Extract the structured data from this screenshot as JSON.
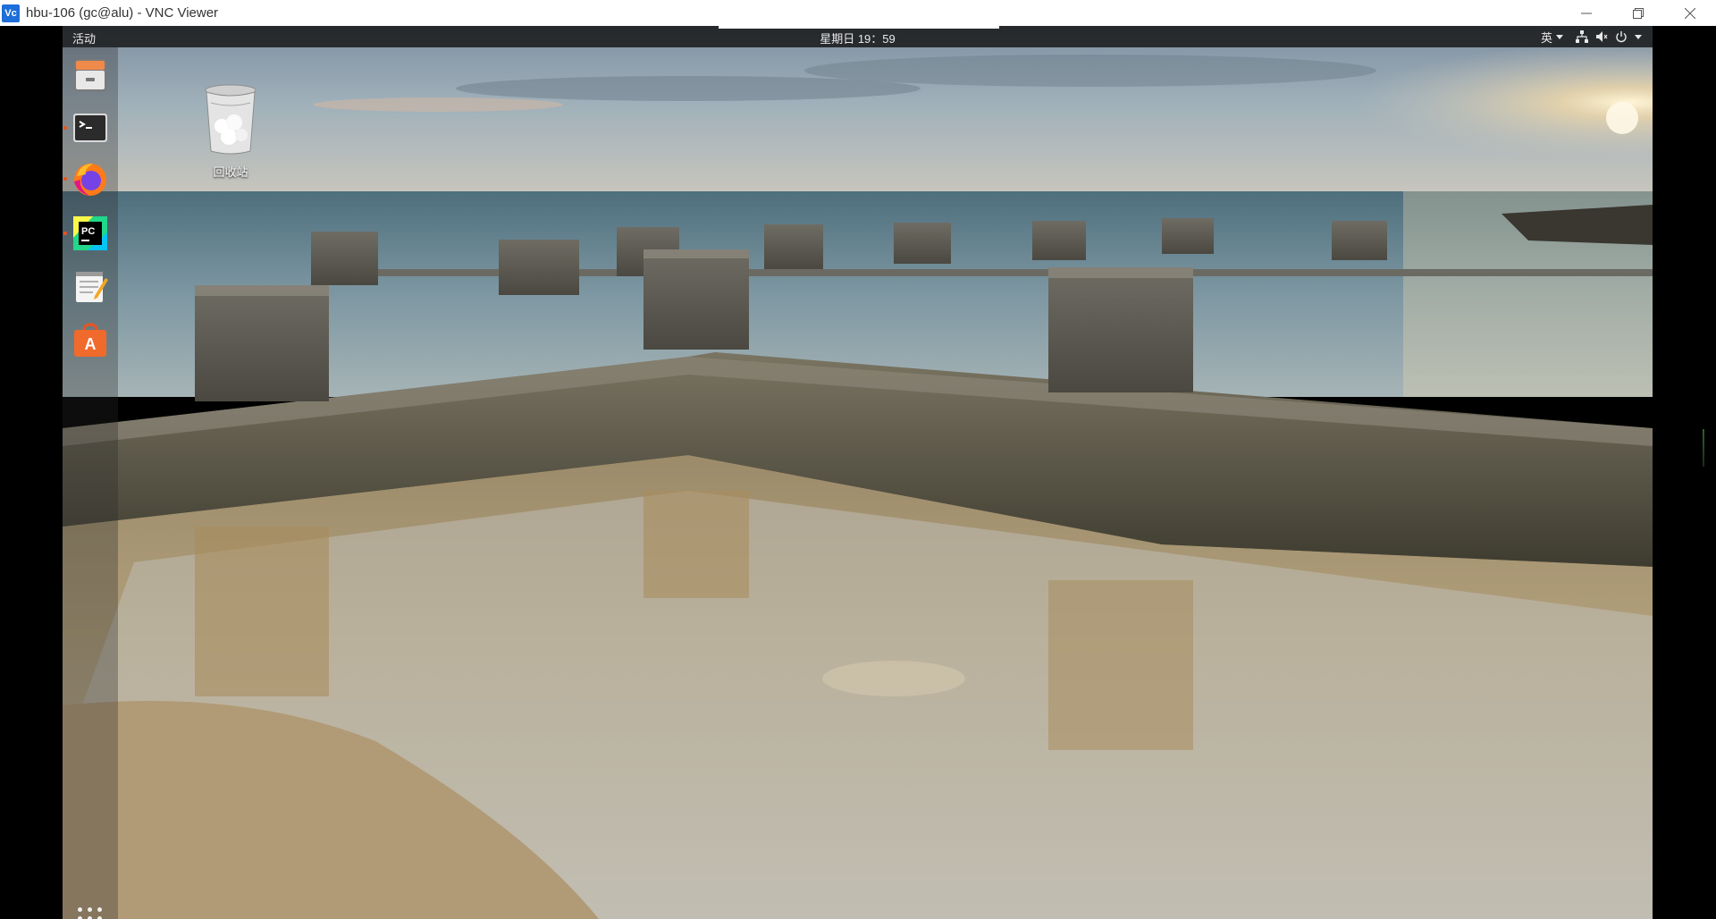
{
  "window": {
    "title": "hbu-106 (gc@alu) - VNC Viewer",
    "app_icon_text": "Vc",
    "controls": [
      "minimize-icon",
      "restore-icon",
      "close-icon"
    ]
  },
  "gnome": {
    "activities": "活动",
    "clock": "星期日 19：59",
    "input_method": "英",
    "tray_icons": [
      "network-wired-icon",
      "volume-muted-icon",
      "power-icon",
      "chevron-down-icon"
    ]
  },
  "dock": {
    "items": [
      {
        "name": "files",
        "icon": "file-cabinet-icon",
        "running": false
      },
      {
        "name": "terminal",
        "icon": "terminal-icon",
        "running": true
      },
      {
        "name": "firefox",
        "icon": "firefox-icon",
        "running": true
      },
      {
        "name": "pycharm",
        "icon": "pycharm-icon",
        "running": true
      },
      {
        "name": "text-editor",
        "icon": "text-editor-icon",
        "running": false
      },
      {
        "name": "software",
        "icon": "software-store-icon",
        "running": false
      }
    ],
    "show_apps_icon": "grid-dots-icon"
  },
  "desktop": {
    "trash_label": "回收站"
  },
  "colors": {
    "accent": "#e95420",
    "topbar": "#1e1e1e",
    "sky": "#8aa3b2",
    "sea": "#5e7f8c",
    "sand": "#b39a72"
  }
}
